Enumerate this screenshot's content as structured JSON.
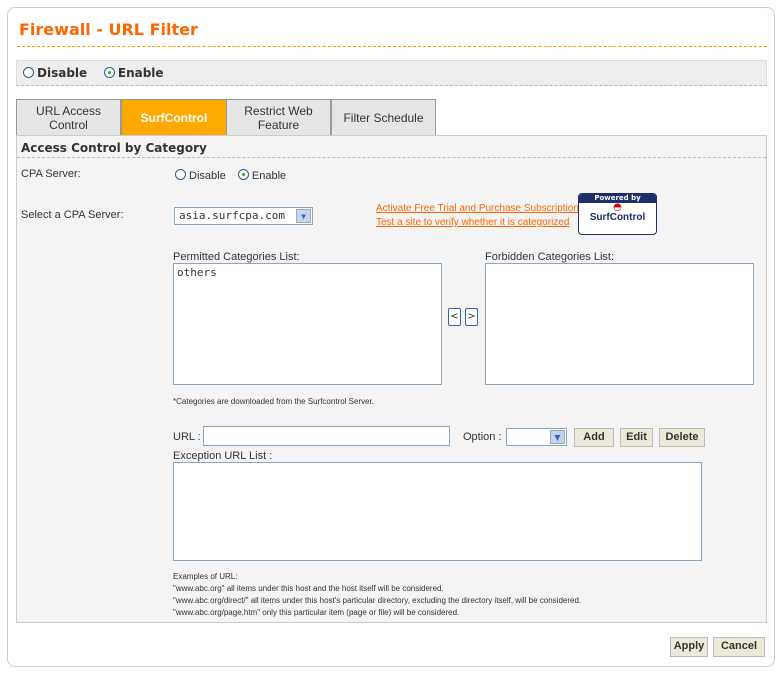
{
  "title": "Firewall - URL Filter",
  "global": {
    "disable": "Disable",
    "enable": "Enable",
    "selected": "enable"
  },
  "tabs": [
    {
      "label": "URL Access Control"
    },
    {
      "label": "SurfControl"
    },
    {
      "label": "Restrict Web Feature"
    },
    {
      "label": "Filter Schedule"
    }
  ],
  "section_title": "Access Control by Category",
  "cpa": {
    "label": "CPA Server:",
    "disable": "Disable",
    "enable": "Enable",
    "selected": "enable"
  },
  "server": {
    "label": "Select a CPA Server:",
    "value": "asia.surfcpa.com"
  },
  "links": {
    "activate": "Activate Free Trial and Purchase Subscription",
    "test": "Test a site to verify whether it is categorized"
  },
  "logo": {
    "top": "Powered by",
    "name": "SurfControl"
  },
  "permitted": {
    "label": "Permitted Categories List:",
    "items": [
      "others"
    ]
  },
  "forbidden": {
    "label": "Forbidden Categories List:",
    "items": []
  },
  "move": {
    "left": "<",
    "right": ">"
  },
  "note": "*Categories are downloaded from the Surfcontrol Server.",
  "url": {
    "label": "URL :",
    "value": "",
    "option_label": "Option :",
    "option_value": ""
  },
  "buttons": {
    "add": "Add",
    "edit": "Edit",
    "delete": "Delete",
    "apply": "Apply",
    "cancel": "Cancel"
  },
  "exception": {
    "label": "Exception URL List :"
  },
  "examples": [
    "Examples of URL:",
    "\"www.abc.org\" all items under this host and the host itself will be considered.",
    "\"www.abc.org/direct/\" all items under this host's particular directory, excluding the directory itself, will be considered.",
    "\"www.abc.org/page.htm\" only this particular item (page or file) will be considered."
  ]
}
